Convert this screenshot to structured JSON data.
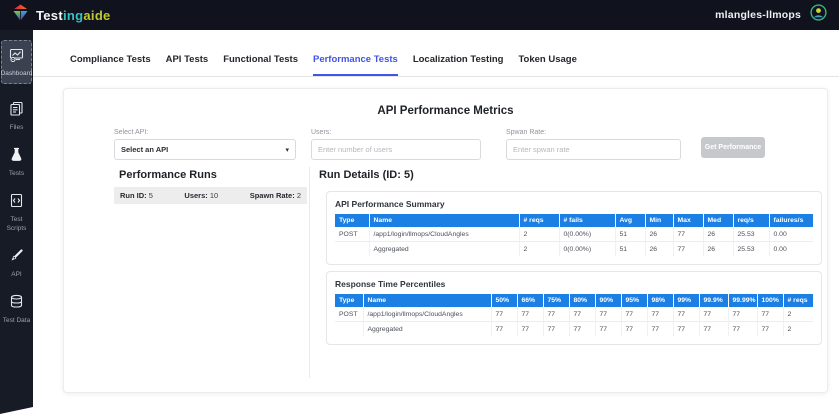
{
  "colors": {
    "header_bg": "#10121d",
    "sidebar_bg": "#161b26",
    "active_tab": "#4254e8",
    "table_header": "#1b7fe4",
    "brand_ing": "#35c2c2",
    "brand_aide": "#c0ca33",
    "button_bg": "#c6c8cc"
  },
  "header": {
    "brand": {
      "part1": "Test",
      "part2": "ing",
      "part3": "aide"
    },
    "user": "mlangles-llmops"
  },
  "sidebar": {
    "items": [
      {
        "label": "Dashboard",
        "active": true
      },
      {
        "label": "Files",
        "active": false
      },
      {
        "label": "Tests",
        "active": false
      },
      {
        "label": "Test Scripts",
        "active": false
      },
      {
        "label": "API",
        "active": false
      },
      {
        "label": "Test Data",
        "active": false
      }
    ]
  },
  "tabs": [
    {
      "label": "Compliance Tests"
    },
    {
      "label": "API Tests"
    },
    {
      "label": "Functional Tests"
    },
    {
      "label": "Performance Tests"
    },
    {
      "label": "Localization Testing"
    },
    {
      "label": "Token Usage"
    }
  ],
  "metrics_form": {
    "title": "API Performance Metrics",
    "select_api_label": "Select API:",
    "select_api_value": "Select an API",
    "users_label": "Users:",
    "users_placeholder": "Enter number of users",
    "spawn_label": "Spwan Rate:",
    "spawn_placeholder": "Enter spwan rate",
    "submit_label": "Get Performance"
  },
  "performance_runs": {
    "title": "Performance Runs",
    "run": {
      "run_id_label": "Run ID:",
      "run_id_value": "5",
      "users_label": "Users:",
      "users_value": "10",
      "spawn_label": "Spawn Rate:",
      "spawn_value": "2"
    }
  },
  "run_details": {
    "title": "Run Details (ID: 5)",
    "summary_table": {
      "title": "API Performance Summary",
      "columns": [
        "Type",
        "Name",
        "# reqs",
        "# fails",
        "Avg",
        "Min",
        "Max",
        "Med",
        "req/s",
        "failures/s"
      ],
      "rows": [
        [
          "POST",
          "/app1/login/llmops/CloudAngles",
          "2",
          "0(0.00%)",
          "51",
          "26",
          "77",
          "26",
          "25.53",
          "0.00"
        ],
        [
          "",
          "Aggregated",
          "2",
          "0(0.00%)",
          "51",
          "26",
          "77",
          "26",
          "25.53",
          "0.00"
        ]
      ]
    },
    "percentiles_table": {
      "title": "Response Time Percentiles",
      "columns": [
        "Type",
        "Name",
        "50%",
        "66%",
        "75%",
        "80%",
        "90%",
        "95%",
        "98%",
        "99%",
        "99.9%",
        "99.99%",
        "100%",
        "# reqs"
      ],
      "rows": [
        [
          "POST",
          "/app1/login/llmops/CloudAngles",
          "77",
          "77",
          "77",
          "77",
          "77",
          "77",
          "77",
          "77",
          "77",
          "77",
          "77",
          "2"
        ],
        [
          "",
          "Aggregated",
          "77",
          "77",
          "77",
          "77",
          "77",
          "77",
          "77",
          "77",
          "77",
          "77",
          "77",
          "2"
        ]
      ]
    }
  }
}
